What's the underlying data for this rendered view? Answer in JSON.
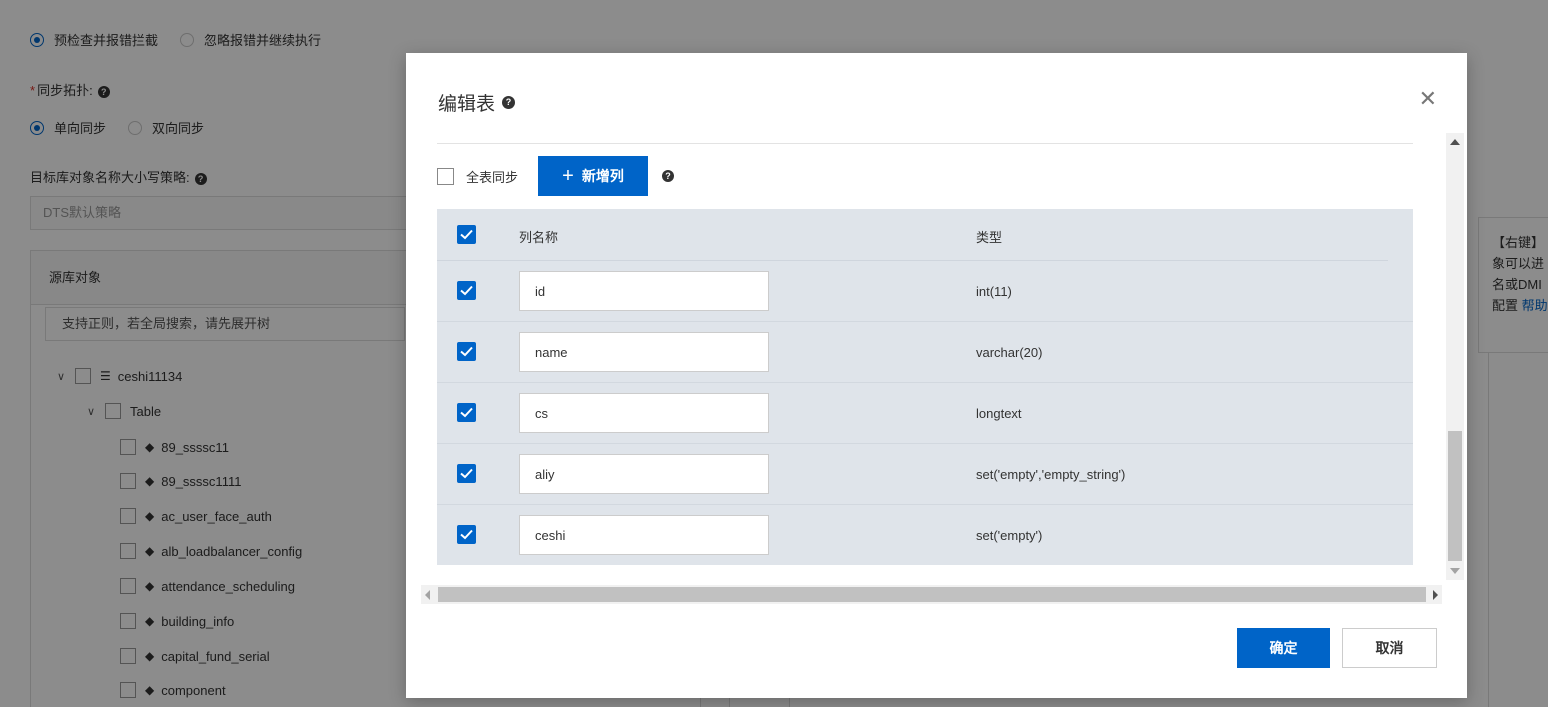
{
  "background": {
    "precheck_options": [
      "预检查并报错拦截",
      "忽略报错并继续执行"
    ],
    "sync_topology_label": "同步拓扑:",
    "topology_options": [
      "单向同步",
      "双向同步"
    ],
    "case_strategy_label": "目标库对象名称大小写策略:",
    "case_strategy_value": "DTS默认策略",
    "source_objects_title": "源库对象",
    "search_placeholder": "支持正则，若全局搜索，请先展开树",
    "tree": {
      "database": "ceshi11134",
      "folder": "Table",
      "tables": [
        "89_ssssc11",
        "89_ssssc1111",
        "ac_user_face_auth",
        "alb_loadbalancer_config",
        "attendance_scheduling",
        "building_info",
        "capital_fund_serial",
        "component"
      ]
    },
    "tooltip_lines": [
      "【右键】",
      "象可以进",
      "名或DMI",
      "配置"
    ],
    "tooltip_link": "帮助"
  },
  "modal": {
    "title": "编辑表",
    "full_table_sync_label": "全表同步",
    "add_column_label": "新增列",
    "header": {
      "name": "列名称",
      "type": "类型"
    },
    "rows": [
      {
        "name": "id",
        "type": "int(11)",
        "checked": true
      },
      {
        "name": "name",
        "type": "varchar(20)",
        "checked": true
      },
      {
        "name": "cs",
        "type": "longtext",
        "checked": true
      },
      {
        "name": "aliy",
        "type": "set('empty','empty_string')",
        "checked": true
      },
      {
        "name": "ceshi",
        "type": "set('empty')",
        "checked": true
      }
    ],
    "ok_label": "确定",
    "cancel_label": "取消"
  },
  "colors": {
    "primary": "#0064c8",
    "grid_bg": "#dfe4ea",
    "required": "#d93026"
  }
}
